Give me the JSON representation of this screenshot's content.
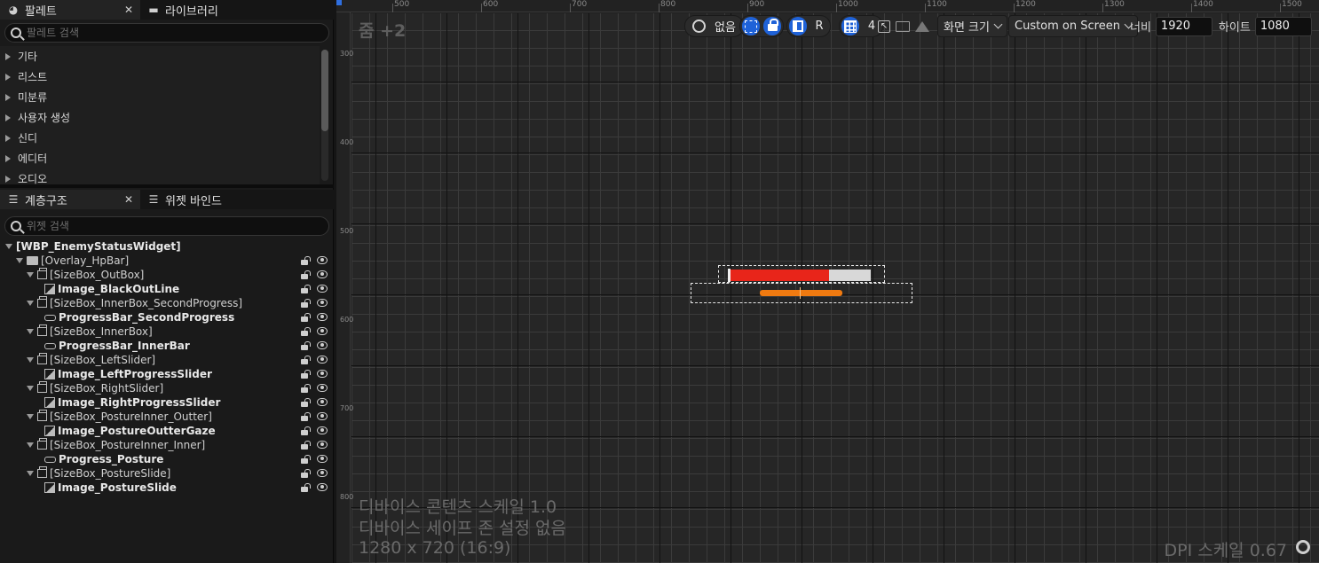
{
  "palette": {
    "tab_label": "팔레트",
    "library_tab_label": "라이브러리",
    "search_placeholder": "팔레트 검색",
    "categories": [
      "기타",
      "리스트",
      "미분류",
      "사용자 생성",
      "신디",
      "에디터",
      "오디오"
    ]
  },
  "hierarchy": {
    "tab_label": "계층구조",
    "binding_tab_label": "위젯 바인드",
    "search_placeholder": "위젯 검색",
    "items": [
      {
        "label": "[WBP_EnemyStatusWidget]",
        "depth": 0,
        "expanded": true,
        "icon": "none",
        "bold": true
      },
      {
        "label": "[Overlay_HpBar]",
        "depth": 1,
        "expanded": true,
        "icon": "overlay-icon",
        "bold": false
      },
      {
        "label": "[SizeBox_OutBox]",
        "depth": 2,
        "expanded": true,
        "icon": "sizebox-icon",
        "bold": false
      },
      {
        "label": "Image_BlackOutLine",
        "depth": 3,
        "expanded": false,
        "icon": "image-icon",
        "bold": true
      },
      {
        "label": "[SizeBox_InnerBox_SecondProgress]",
        "depth": 2,
        "expanded": true,
        "icon": "sizebox-icon",
        "bold": false
      },
      {
        "label": "ProgressBar_SecondProgress",
        "depth": 3,
        "expanded": false,
        "icon": "progressbar-icon",
        "bold": true
      },
      {
        "label": "[SizeBox_InnerBox]",
        "depth": 2,
        "expanded": true,
        "icon": "sizebox-icon",
        "bold": false
      },
      {
        "label": "ProgressBar_InnerBar",
        "depth": 3,
        "expanded": false,
        "icon": "progressbar-icon",
        "bold": true
      },
      {
        "label": "[SizeBox_LeftSlider]",
        "depth": 2,
        "expanded": true,
        "icon": "sizebox-icon",
        "bold": false
      },
      {
        "label": "Image_LeftProgressSlider",
        "depth": 3,
        "expanded": false,
        "icon": "image-icon",
        "bold": true
      },
      {
        "label": "[SizeBox_RightSlider]",
        "depth": 2,
        "expanded": true,
        "icon": "sizebox-icon",
        "bold": false
      },
      {
        "label": "Image_RightProgressSlider",
        "depth": 3,
        "expanded": false,
        "icon": "image-icon",
        "bold": true
      },
      {
        "label": "[SizeBox_PostureInner_Outter]",
        "depth": 2,
        "expanded": true,
        "icon": "sizebox-icon",
        "bold": false
      },
      {
        "label": "Image_PostureOutterGaze",
        "depth": 3,
        "expanded": false,
        "icon": "image-icon",
        "bold": true
      },
      {
        "label": "[SizeBox_PostureInner_Inner]",
        "depth": 2,
        "expanded": true,
        "icon": "sizebox-icon",
        "bold": false
      },
      {
        "label": "Progress_Posture",
        "depth": 3,
        "expanded": false,
        "icon": "progressbar-icon",
        "bold": true
      },
      {
        "label": "[SizeBox_PostureSlide]",
        "depth": 2,
        "expanded": true,
        "icon": "sizebox-icon",
        "bold": false
      },
      {
        "label": "Image_PostureSlide",
        "depth": 3,
        "expanded": false,
        "icon": "image-icon",
        "bold": true
      }
    ]
  },
  "toolbar": {
    "localization_value": "없음",
    "r_label": "R",
    "grid_snap_value": "4",
    "screen_size_label": "화면 크기",
    "fill_mode_label": "Custom on Screen",
    "width_label": "너비",
    "width_value": "1920",
    "height_label": "하이트",
    "height_value": "1080"
  },
  "designer": {
    "zoom_label": "줌 +2",
    "ruler_x_labels": [
      "500",
      "600",
      "700",
      "800",
      "900",
      "1000",
      "1100",
      "1200",
      "1300",
      "1400",
      "1500"
    ],
    "ruler_y_labels": [
      "300",
      "400",
      "500",
      "600",
      "700",
      "800"
    ],
    "device_content_scale": "디바이스 콘텐츠 스케일 1.0",
    "device_safe_zone": "디바이스 세이프 존 설정 없음",
    "resolution_text": "1280 x 720 (16:9)",
    "dpi_scale": "DPI 스케일 0.67",
    "hp_bar_fill_fraction": 0.71
  },
  "colors": {
    "accent_blue": "#1f62d8",
    "hp_fill": "#e8251a",
    "hp_background": "#d8d8d8",
    "posture_bar": "#f07a10"
  }
}
